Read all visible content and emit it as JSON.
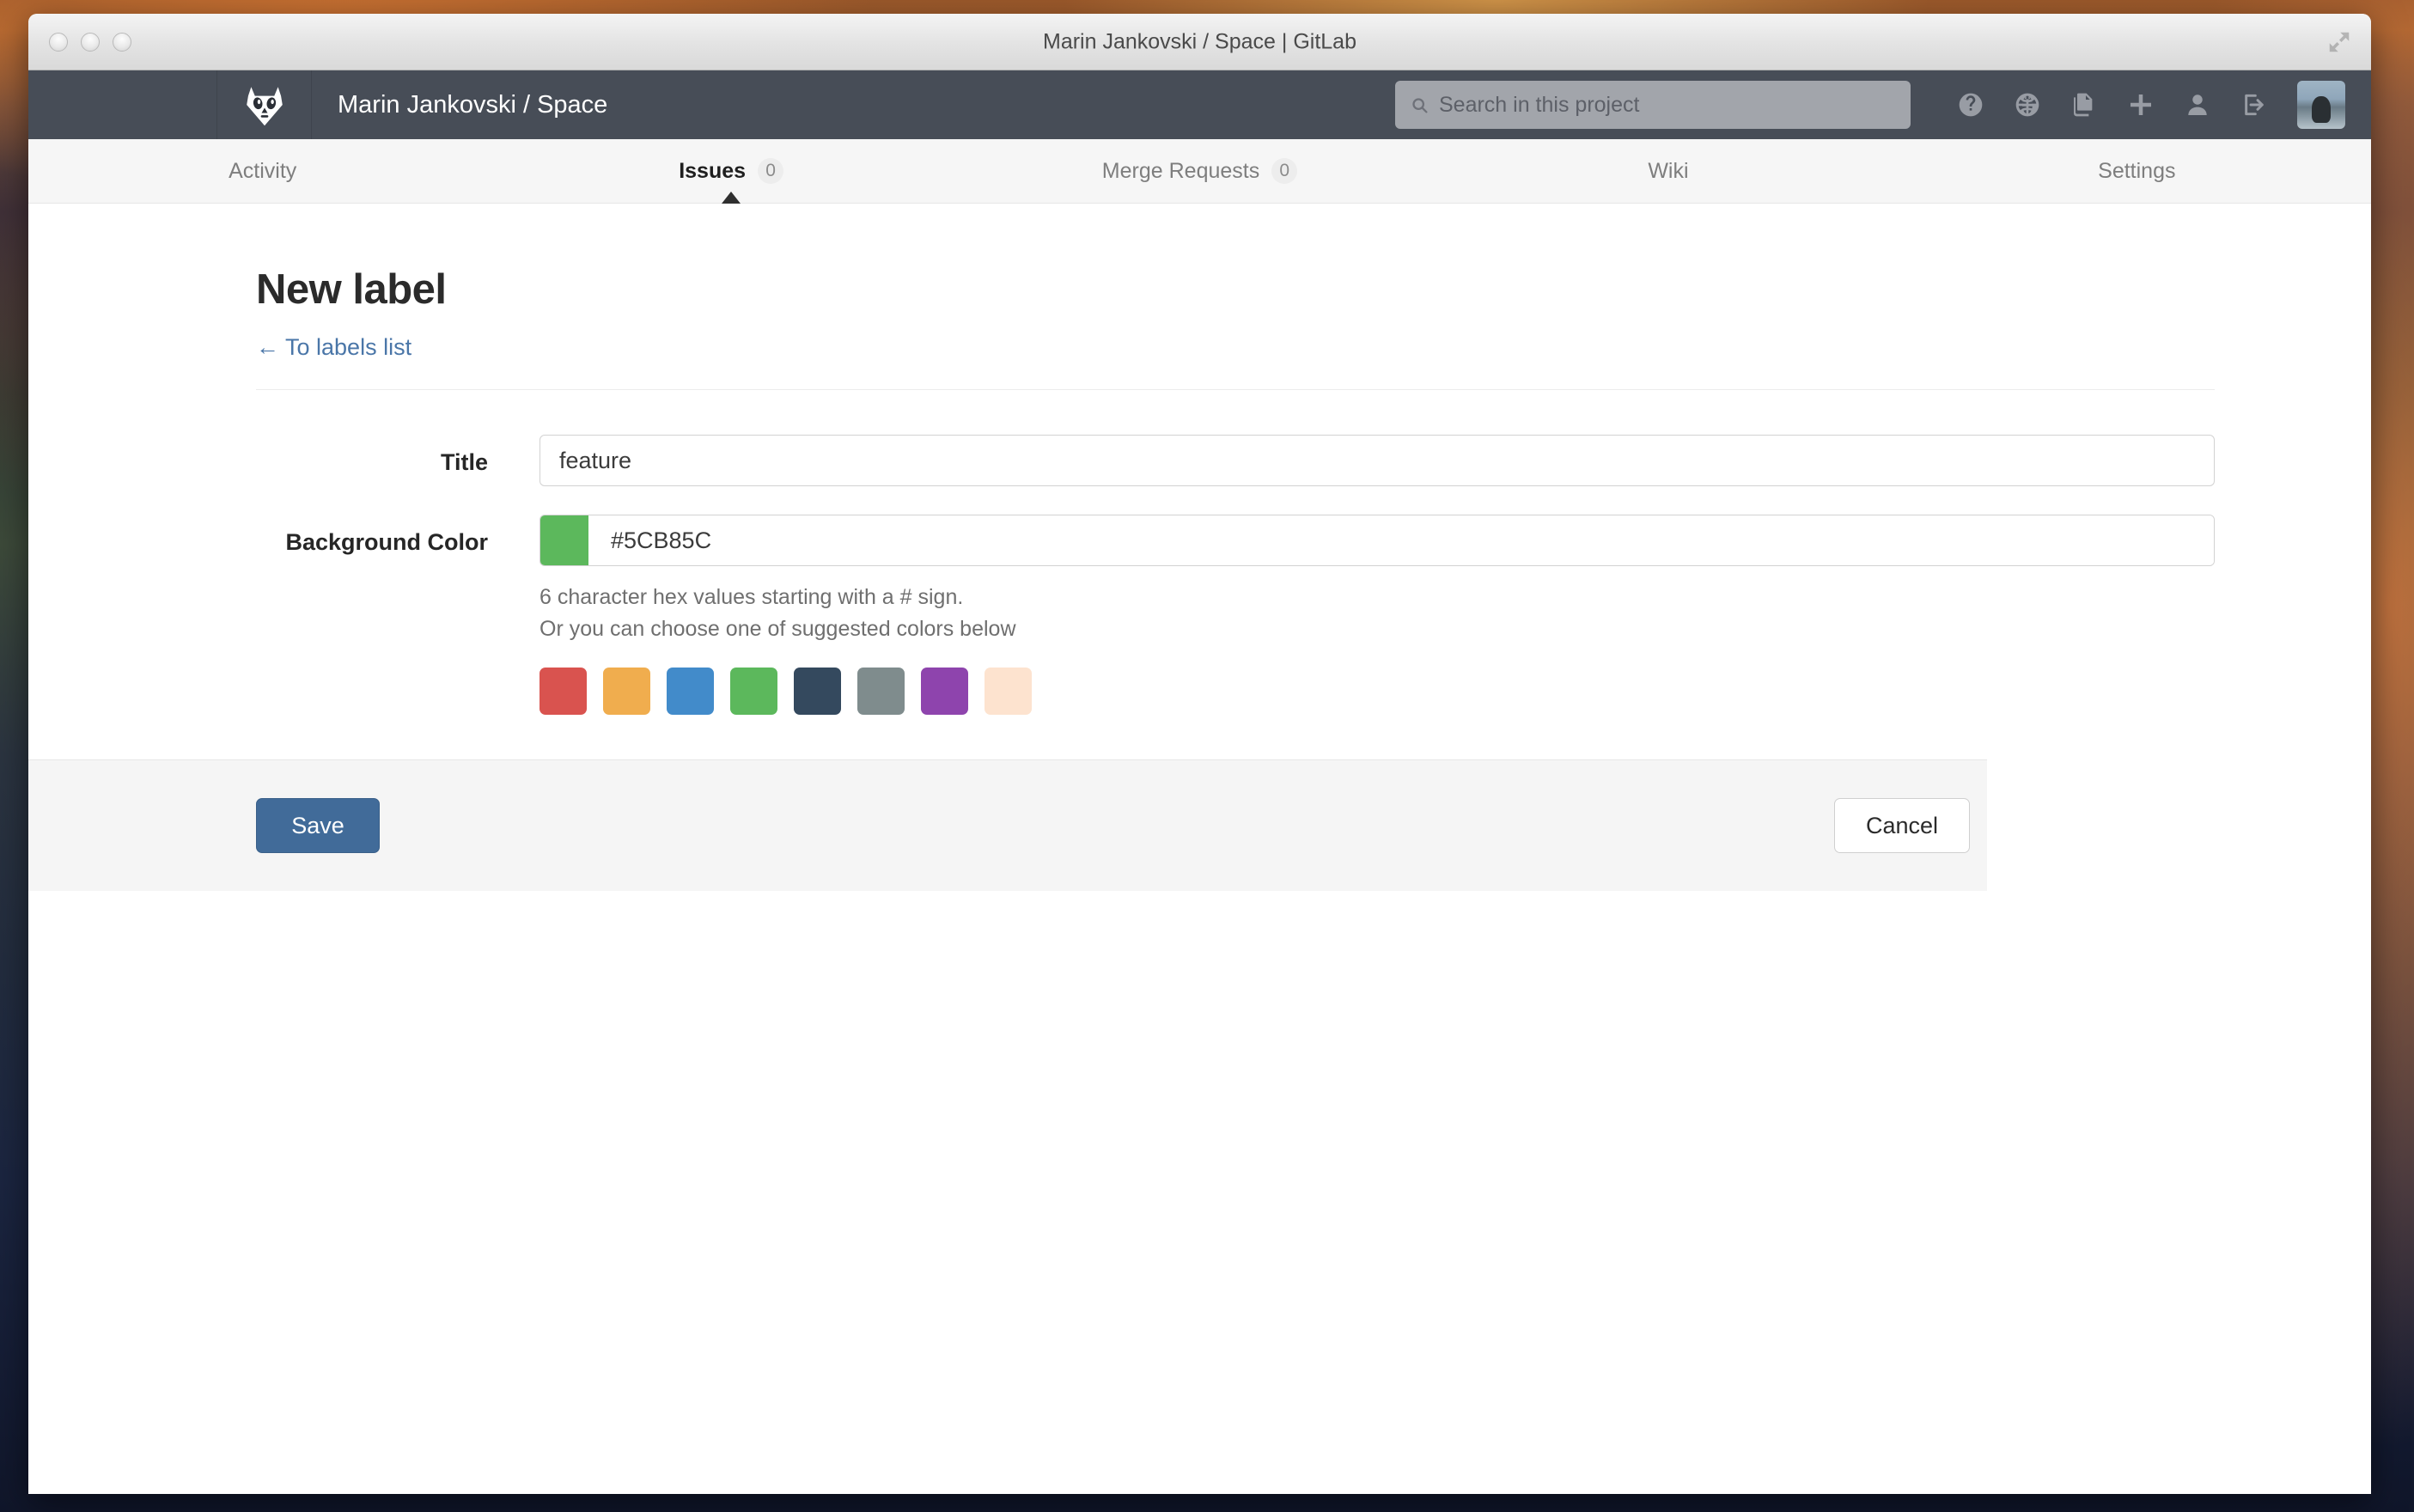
{
  "window": {
    "title": "Marin Jankovski / Space | GitLab",
    "traffic_lights": [
      "close",
      "minimize",
      "zoom"
    ],
    "expand_icon": "fullscreen-icon"
  },
  "navbar": {
    "logo_icon": "gitlab-fox-logo",
    "project": "Marin Jankovski / Space",
    "search": {
      "icon": "search-icon",
      "placeholder": "Search in this project",
      "value": ""
    },
    "icons": [
      {
        "name": "help-icon",
        "glyph": "?"
      },
      {
        "name": "globe-icon",
        "glyph": "globe"
      },
      {
        "name": "files-icon",
        "glyph": "files"
      },
      {
        "name": "plus-icon",
        "glyph": "+"
      },
      {
        "name": "user-icon",
        "glyph": "user"
      },
      {
        "name": "sign-out-icon",
        "glyph": "sign-out"
      }
    ],
    "avatar_alt": "avatar"
  },
  "tabs": [
    {
      "label": "Activity",
      "count": "",
      "active": false
    },
    {
      "label": "Issues",
      "count": "0",
      "active": true
    },
    {
      "label": "Merge Requests",
      "count": "0",
      "active": false
    },
    {
      "label": "Wiki",
      "count": "",
      "active": false
    },
    {
      "label": "Settings",
      "count": "",
      "active": false
    }
  ],
  "page": {
    "title": "New label",
    "back_link": "← To labels list"
  },
  "form": {
    "title_label": "Title",
    "title_value": "feature",
    "title_placeholder": "",
    "color_label": "Background Color",
    "color_value": "#5CB85C",
    "color_placeholder": "",
    "swatch_color": "#5CB85C",
    "help_line_1": "6 character hex values starting with a # sign.",
    "help_line_2": "Or you can choose one of suggested colors below",
    "suggested_colors": [
      "#D9534F",
      "#F0AD4E",
      "#428BCA",
      "#5CB85C",
      "#34495E",
      "#7F8C8D",
      "#8E44AD",
      "#FDE3CF"
    ],
    "save_label": "Save",
    "cancel_label": "Cancel"
  },
  "theme": {
    "navbar_bg": "#474D57",
    "accent_blue": "#416B99",
    "link_blue": "#4A76A8",
    "footer_bg": "#F5F5F5"
  }
}
